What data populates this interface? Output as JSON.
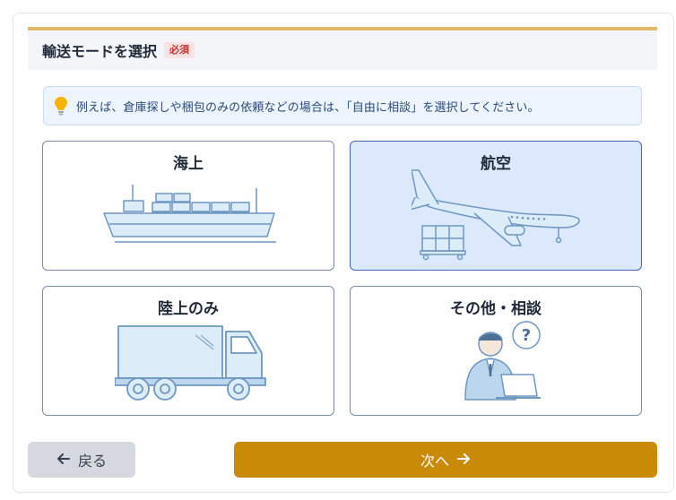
{
  "section": {
    "title": "輸送モードを選択",
    "required_badge": "必須"
  },
  "hint": {
    "icon": "lightbulb-icon",
    "text": "例えば、倉庫探しや梱包のみの依頼などの場合は、「自由に相談」を選択してください。"
  },
  "options": [
    {
      "label": "海上",
      "icon": "cargo-ship-icon",
      "selected": false
    },
    {
      "label": "航空",
      "icon": "airplane-icon",
      "selected": true
    },
    {
      "label": "陸上のみ",
      "icon": "truck-icon",
      "selected": false
    },
    {
      "label": "その他・相談",
      "icon": "consultant-icon",
      "selected": false
    }
  ],
  "navigation": {
    "back_label": "戻る",
    "next_label": "次へ"
  },
  "colors": {
    "accent": "#c98a06",
    "header_border": "#e2b86a",
    "selected_bg": "#dce9fd",
    "selected_border": "#4a63b5",
    "illustration_stroke": "#6f97c0",
    "illustration_fill": "#dcecf8"
  }
}
